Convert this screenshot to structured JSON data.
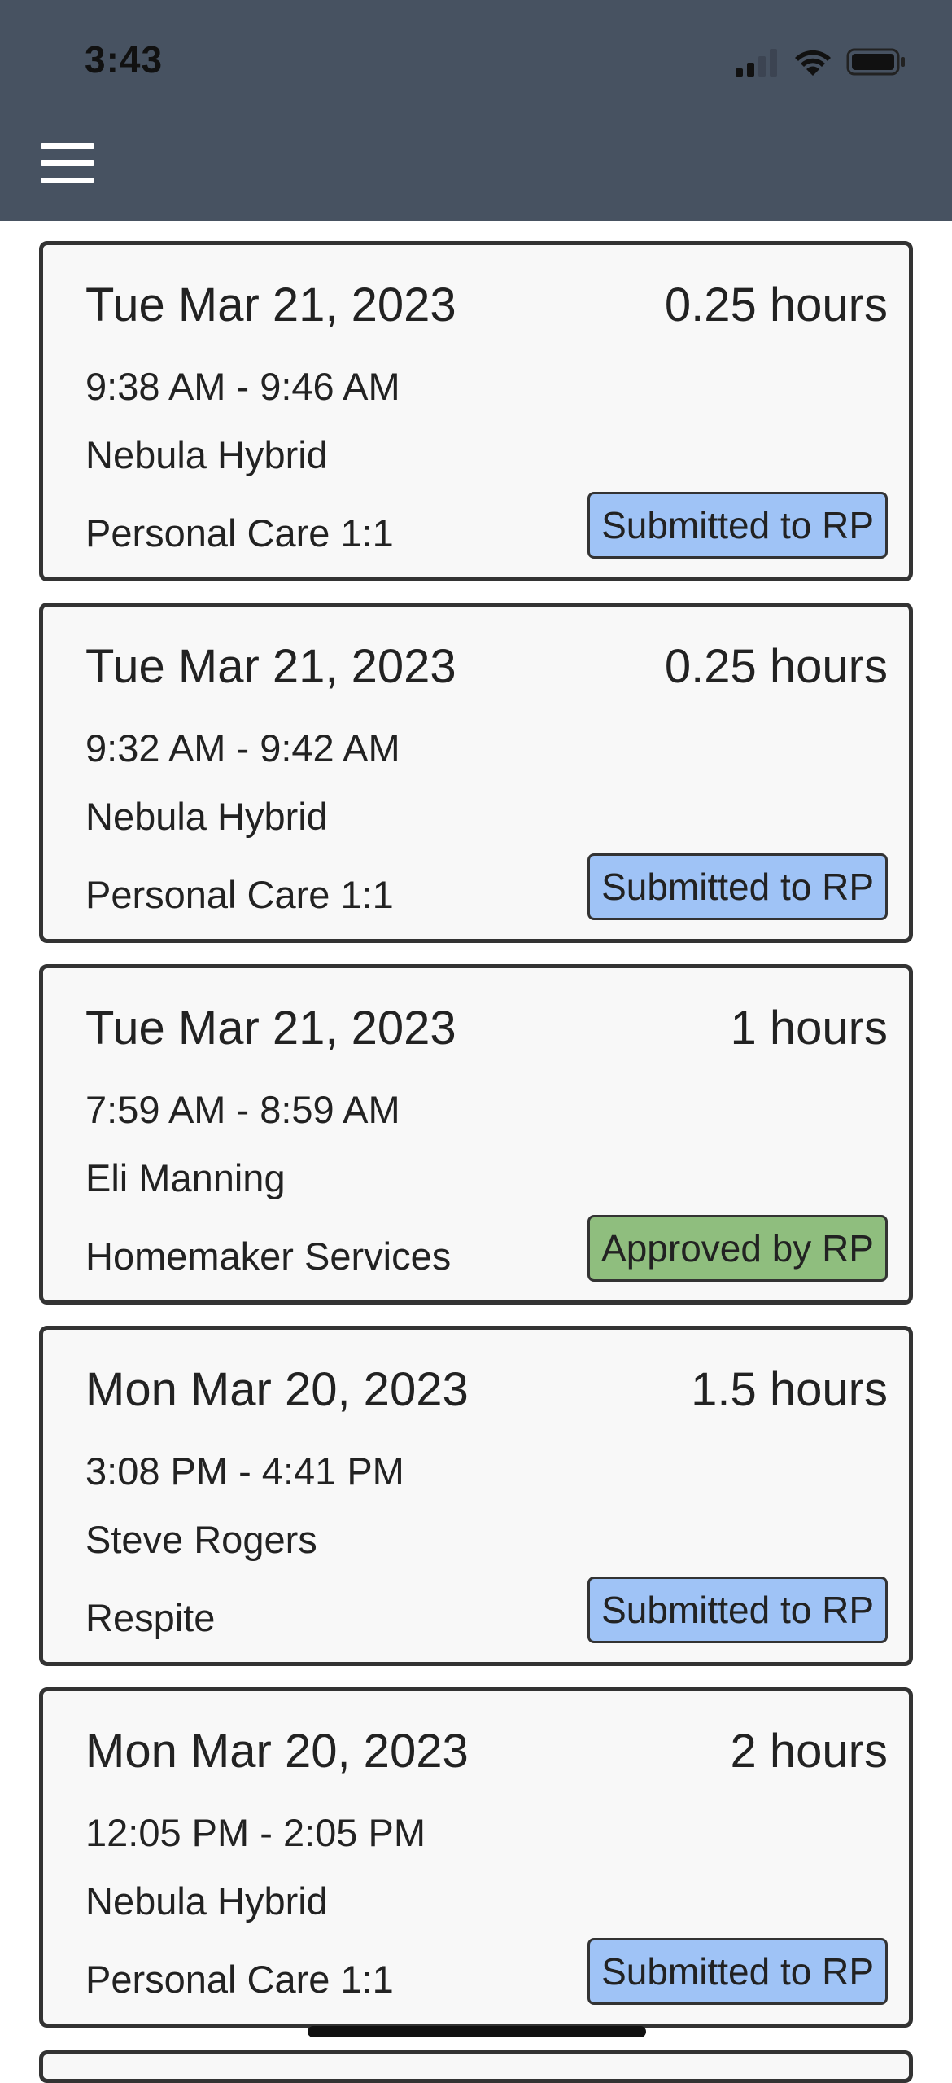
{
  "status_bar": {
    "time": "3:43"
  },
  "colors": {
    "header_bg": "#475261",
    "submitted_badge": "#9fc3f6",
    "approved_badge": "#8fbe7e"
  },
  "entries": [
    {
      "date": "Tue Mar 21, 2023",
      "hours": "0.25 hours",
      "time_range": "9:38 AM - 9:46 AM",
      "client": "Nebula Hybrid",
      "service": "Personal Care 1:1",
      "status": "Submitted to RP",
      "status_color": "#9fc3f6"
    },
    {
      "date": "Tue Mar 21, 2023",
      "hours": "0.25 hours",
      "time_range": "9:32 AM - 9:42 AM",
      "client": "Nebula Hybrid",
      "service": "Personal Care 1:1",
      "status": "Submitted to RP",
      "status_color": "#9fc3f6"
    },
    {
      "date": "Tue Mar 21, 2023",
      "hours": "1 hours",
      "time_range": "7:59 AM - 8:59 AM",
      "client": "Eli Manning",
      "service": "Homemaker Services",
      "status": "Approved by RP",
      "status_color": "#8fbe7e"
    },
    {
      "date": "Mon Mar 20, 2023",
      "hours": "1.5 hours",
      "time_range": "3:08 PM - 4:41 PM",
      "client": "Steve Rogers",
      "service": "Respite",
      "status": "Submitted to RP",
      "status_color": "#9fc3f6"
    },
    {
      "date": "Mon Mar 20, 2023",
      "hours": "2 hours",
      "time_range": "12:05 PM - 2:05 PM",
      "client": "Nebula Hybrid",
      "service": "Personal Care 1:1",
      "status": "Submitted to RP",
      "status_color": "#9fc3f6"
    }
  ]
}
